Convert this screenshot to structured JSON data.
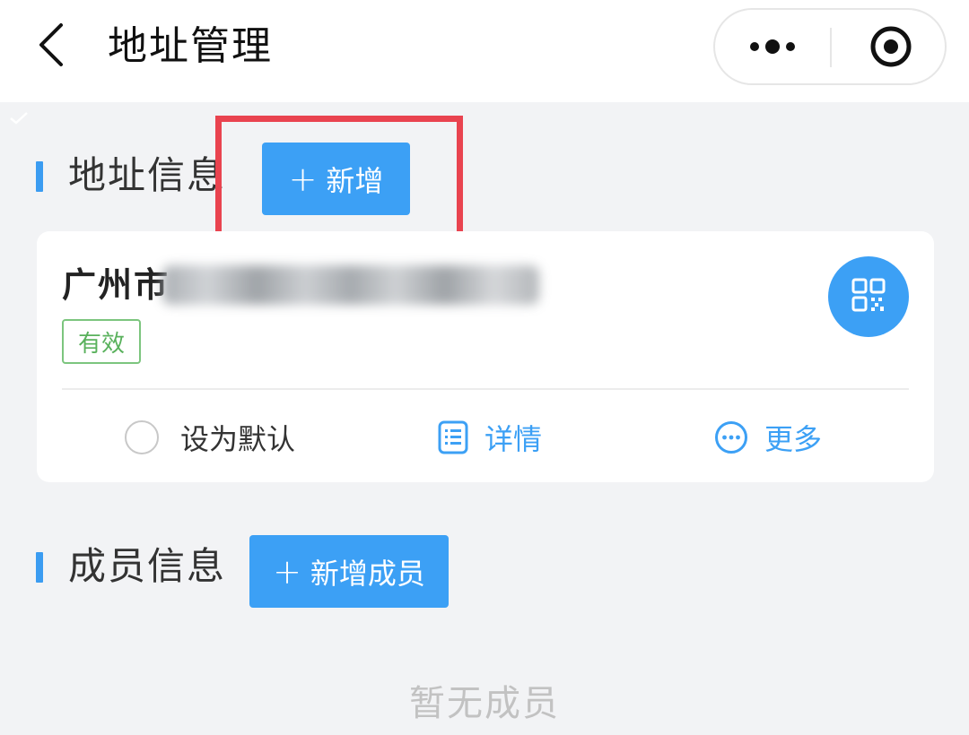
{
  "header": {
    "title": "地址管理",
    "back_icon": "chevron-left-icon",
    "menu_icon": "more-dots-icon",
    "close_icon": "target-circle-icon"
  },
  "address_section": {
    "title": "地址信息",
    "add_label": "新增",
    "add_icon": "plus-icon"
  },
  "address_card": {
    "address_visible": "广州市",
    "status": "有效",
    "qr_icon": "qr-code-icon",
    "actions": [
      {
        "label": "设为默认",
        "icon": "radio-icon"
      },
      {
        "label": "详情",
        "icon": "list-doc-icon"
      },
      {
        "label": "更多",
        "icon": "more-circle-icon"
      }
    ]
  },
  "member_section": {
    "title": "成员信息",
    "add_label": "新增成员",
    "add_icon": "plus-icon",
    "empty_text": "暂无成员"
  },
  "colors": {
    "accent": "#3ca0f5",
    "highlight": "#e9434f",
    "status_green": "#59b15c",
    "background": "#f2f3f5"
  }
}
